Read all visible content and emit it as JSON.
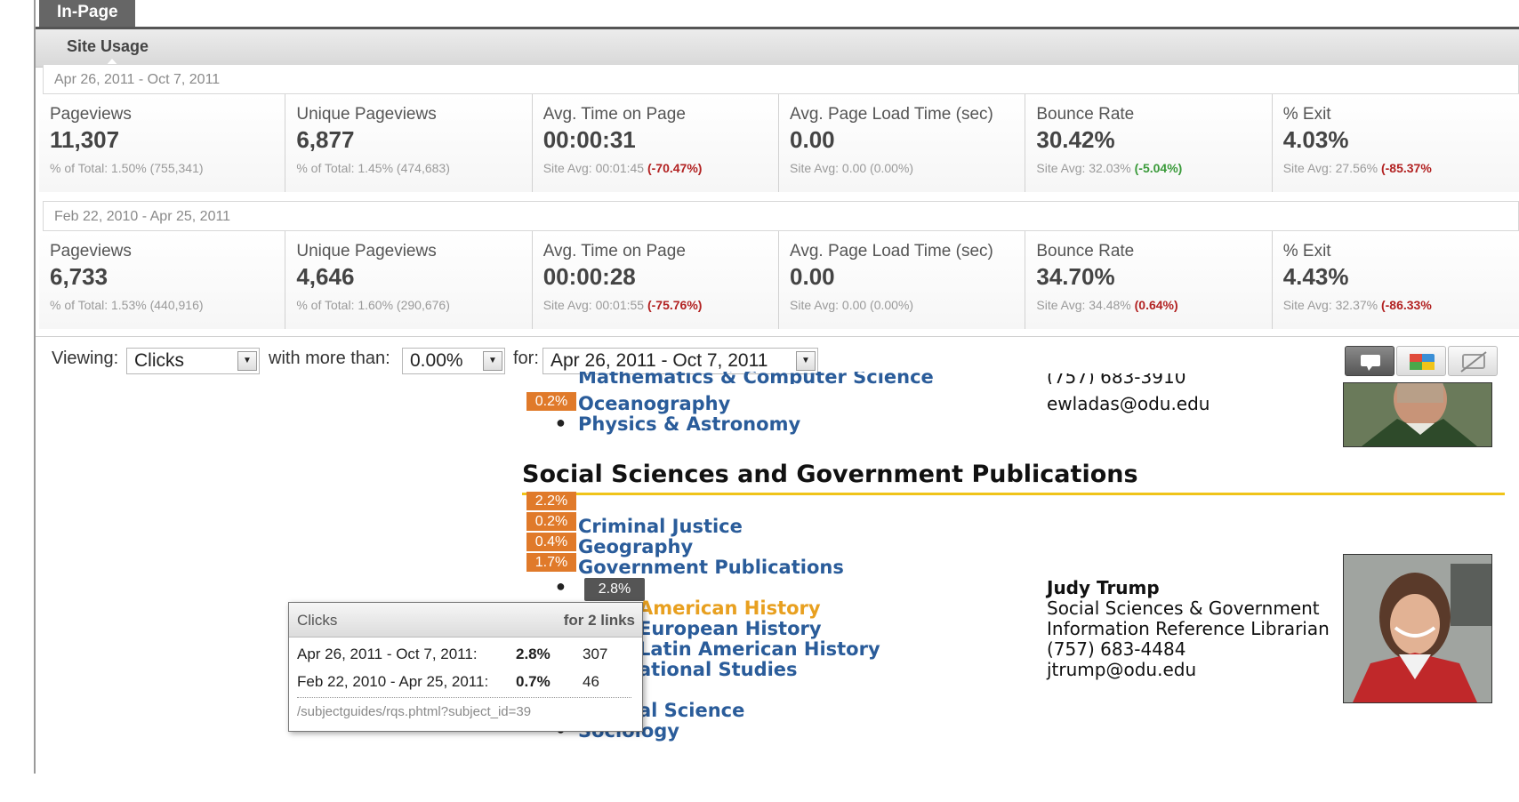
{
  "tab": {
    "label": "In-Page"
  },
  "subtab": {
    "label": "Site Usage"
  },
  "period1": {
    "range": "Apr 26, 2011 - Oct 7, 2011",
    "metrics": [
      {
        "label": "Pageviews",
        "value": "11,307",
        "sub_prefix": "% of Total: 1.50% (755,341)",
        "sub_delta": ""
      },
      {
        "label": "Unique Pageviews",
        "value": "6,877",
        "sub_prefix": "% of Total: 1.45% (474,683)",
        "sub_delta": ""
      },
      {
        "label": "Avg. Time on Page",
        "value": "00:00:31",
        "sub_prefix": "Site Avg: 00:01:45 ",
        "sub_delta": "(-70.47%)"
      },
      {
        "label": "Avg. Page Load Time (sec)",
        "value": "0.00",
        "sub_prefix": "Site Avg: 0.00 (0.00%)",
        "sub_delta": ""
      },
      {
        "label": "Bounce Rate",
        "value": "30.42%",
        "sub_prefix": "Site Avg: 32.03% ",
        "sub_delta": "(-5.04%)"
      },
      {
        "label": "% Exit",
        "value": "4.03%",
        "sub_prefix": "Site Avg: 27.56% ",
        "sub_delta": "(-85.37%"
      }
    ]
  },
  "period2": {
    "range": "Feb 22, 2010 - Apr 25, 2011",
    "metrics": [
      {
        "label": "Pageviews",
        "value": "6,733",
        "sub_prefix": "% of Total: 1.53% (440,916)",
        "sub_delta": ""
      },
      {
        "label": "Unique Pageviews",
        "value": "4,646",
        "sub_prefix": "% of Total: 1.60% (290,676)",
        "sub_delta": ""
      },
      {
        "label": "Avg. Time on Page",
        "value": "00:00:28",
        "sub_prefix": "Site Avg: 00:01:55 ",
        "sub_delta": "(-75.76%)"
      },
      {
        "label": "Avg. Page Load Time (sec)",
        "value": "0.00",
        "sub_prefix": "Site Avg: 0.00 (0.00%)",
        "sub_delta": ""
      },
      {
        "label": "Bounce Rate",
        "value": "34.70%",
        "sub_prefix": "Site Avg: 34.48% ",
        "sub_delta": "(0.64%)"
      },
      {
        "label": "% Exit",
        "value": "4.43%",
        "sub_prefix": "Site Avg: 32.37% ",
        "sub_delta": "(-86.33%"
      }
    ]
  },
  "viewbar": {
    "viewing_label": "Viewing:",
    "viewing_value": "Clicks",
    "more_label": "with more than:",
    "more_value": "0.00%",
    "for_label": "for:",
    "for_value": "Apr 26, 2011 - Oct 7, 2011"
  },
  "page": {
    "top_cut_link": "Mathematics & Computer Science",
    "oceanography_pct": "0.2%",
    "oceanography": "Oceanography",
    "physics": "Physics & Astronomy",
    "contact1_phone_cut": "(757) 683-3910",
    "contact1_email": "ewladas@odu.edu",
    "heading": "Social Sciences and Government Publications",
    "pcts": [
      "2.2%",
      "0.2%",
      "0.4%",
      "1.7%"
    ],
    "links": [
      "Criminal Justice",
      "Geography",
      "Government Publications"
    ],
    "hover_pct": "2.8%",
    "history_fragment": "y",
    "american_history": "American History",
    "european_history": "European History",
    "latin_history": "Latin American History",
    "international_fragment": "ational Studies",
    "political_fragment": "al Science",
    "sociology": "Sociology",
    "contact2": {
      "name": "Judy Trump",
      "title1": "Social Sciences & Government",
      "title2": "Information Reference Librarian",
      "phone": "(757) 683-4484",
      "email": "jtrump@odu.edu"
    }
  },
  "tooltip": {
    "title": "Clicks",
    "links_label": "for 2 links",
    "rows": [
      {
        "range": "Apr 26, 2011 - Oct 7, 2011:",
        "pct": "2.8%",
        "count": "307"
      },
      {
        "range": "Feb 22, 2010 - Apr 25, 2011:",
        "pct": "0.7%",
        "count": "46"
      }
    ],
    "url": "/subjectguides/rqs.phtml?subject_id=39"
  },
  "colors": {
    "accent_orange": "#e07a2a",
    "link_blue": "#2a5c9a",
    "hover_link": "#e8a020",
    "negative": "#b22222",
    "positive": "#3a9a3a"
  }
}
